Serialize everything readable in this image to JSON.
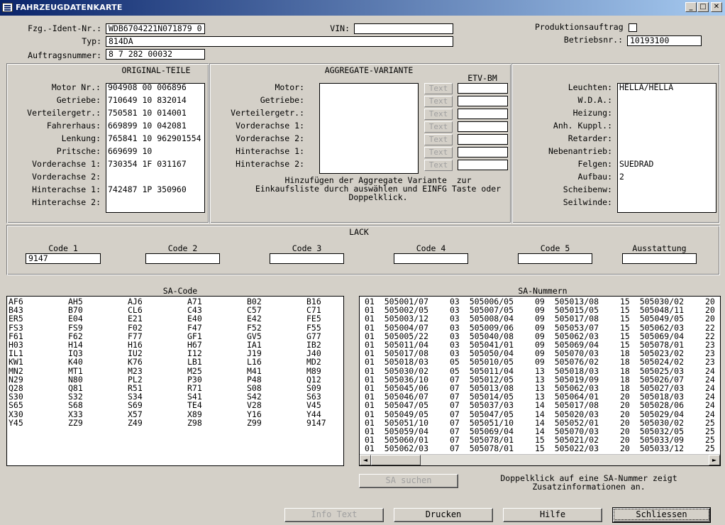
{
  "window": {
    "title": "FAHRZEUGDATENKARTE",
    "min_glyph": "_",
    "max_glyph": "□",
    "close_glyph": "✕"
  },
  "header": {
    "fzg_label": "Fzg.-Ident-Nr.:",
    "fzg_value": "WDB6704221N071879 0",
    "vin_label": "VIN:",
    "vin_value": "",
    "typ_label": "Typ:",
    "typ_value": "814DA",
    "auftrag_label": "Auftragsnummer:",
    "auftrag_value": "8 7 282 00032",
    "produktion_label": "Produktionsauftrag",
    "betrieb_label": "Betriebsnr.:",
    "betrieb_value": "10193100"
  },
  "original": {
    "title": "ORIGINAL-TEILE",
    "rows": [
      {
        "label": "Motor Nr.:",
        "value": "904908 00 006896"
      },
      {
        "label": "Getriebe:",
        "value": "710649 10 832014"
      },
      {
        "label": "Verteilergetr.:",
        "value": "750581 10 014001"
      },
      {
        "label": "Fahrerhaus:",
        "value": "669899 10 042081"
      },
      {
        "label": "Lenkung:",
        "value": "765841 10 962901554"
      },
      {
        "label": "Pritsche:",
        "value": "669699 10"
      },
      {
        "label": "Vorderachse 1:",
        "value": "730354 1F 031167"
      },
      {
        "label": "Vorderachse 2:",
        "value": ""
      },
      {
        "label": "Hinterachse 1:",
        "value": "742487 1P 350960"
      },
      {
        "label": "Hinterachse 2:",
        "value": ""
      }
    ]
  },
  "aggregate": {
    "title": "AGGREGATE-VARIANTE",
    "etv_header": "ETV-BM",
    "text_button": "Text",
    "rows": [
      "Motor:",
      "Getriebe:",
      "Verteilergetr.:",
      "Vorderachse 1:",
      "Vorderachse 2:",
      "Hinterachse 1:",
      "Hinterachse 2:"
    ],
    "hint_lines": [
      "Hinzufügen der Aggregate Variante  zur",
      "Einkaufsliste durch auswählen und EINFG Taste oder",
      "Doppelklick."
    ]
  },
  "equipment": {
    "rows": [
      {
        "label": "Leuchten:",
        "value": "HELLA/HELLA"
      },
      {
        "label": "W.D.A.:",
        "value": ""
      },
      {
        "label": "Heizung:",
        "value": ""
      },
      {
        "label": "Anh. Kuppl.:",
        "value": ""
      },
      {
        "label": "Retarder:",
        "value": ""
      },
      {
        "label": "Nebenantrieb:",
        "value": ""
      },
      {
        "label": "Felgen:",
        "value": "SUEDRAD"
      },
      {
        "label": "Aufbau:",
        "value": "2"
      },
      {
        "label": "Scheibenw:",
        "value": ""
      },
      {
        "label": "Seilwinde:",
        "value": ""
      }
    ]
  },
  "lack": {
    "title": "LACK",
    "fields": [
      {
        "label": "Code 1",
        "value": "9147"
      },
      {
        "label": "Code 2",
        "value": ""
      },
      {
        "label": "Code 3",
        "value": ""
      },
      {
        "label": "Code 4",
        "value": ""
      },
      {
        "label": "Code 5",
        "value": ""
      },
      {
        "label": "Ausstattung",
        "value": ""
      }
    ]
  },
  "sa_code": {
    "title": "SA-Code",
    "rows": [
      [
        "AF6",
        "AH5",
        "AJ6",
        "A71",
        "B02",
        "B16"
      ],
      [
        "B43",
        "B70",
        "CL6",
        "C43",
        "C57",
        "C71"
      ],
      [
        "ER5",
        "E04",
        "E21",
        "E40",
        "E42",
        "FE5"
      ],
      [
        "FS3",
        "FS9",
        "F02",
        "F47",
        "F52",
        "F55"
      ],
      [
        "F61",
        "F62",
        "F77",
        "GF1",
        "GV5",
        "G77"
      ],
      [
        "H03",
        "H14",
        "H16",
        "H67",
        "IA1",
        "IB2"
      ],
      [
        "IL1",
        "IQ3",
        "IU2",
        "I12",
        "J19",
        "J40"
      ],
      [
        "KW1",
        "K40",
        "K76",
        "LB1",
        "L16",
        "MD2"
      ],
      [
        "MN2",
        "MT1",
        "M23",
        "M25",
        "M41",
        "M89"
      ],
      [
        "N29",
        "N80",
        "PL2",
        "P30",
        "P48",
        "Q12"
      ],
      [
        "Q28",
        "Q81",
        "R51",
        "R71",
        "S08",
        "S09"
      ],
      [
        "S30",
        "S32",
        "S34",
        "S41",
        "S42",
        "S63"
      ],
      [
        "S65",
        "S68",
        "S69",
        "TE4",
        "V28",
        "V45"
      ],
      [
        "X30",
        "X33",
        "X57",
        "X89",
        "Y16",
        "Y44"
      ],
      [
        "Y45",
        "ZZ9",
        "Z49",
        "Z98",
        "Z99",
        "9147"
      ]
    ]
  },
  "sa_nummern": {
    "title": "SA-Nummern",
    "rows": [
      [
        "01  505001/07",
        "03  505006/05",
        "09  505013/08",
        "15  505030/02",
        "20"
      ],
      [
        "01  505002/05",
        "03  505007/05",
        "09  505015/05",
        "15  505048/11",
        "20"
      ],
      [
        "01  505003/12",
        "03  505008/04",
        "09  505017/08",
        "15  505049/05",
        "20"
      ],
      [
        "01  505004/07",
        "03  505009/06",
        "09  505053/07",
        "15  505062/03",
        "22"
      ],
      [
        "01  505005/22",
        "03  505040/08",
        "09  505062/03",
        "15  505069/04",
        "22"
      ],
      [
        "01  505011/04",
        "03  505041/01",
        "09  505069/04",
        "15  505078/01",
        "23"
      ],
      [
        "01  505017/08",
        "03  505050/04",
        "09  505070/03",
        "18  505023/02",
        "23"
      ],
      [
        "01  505018/03",
        "05  505010/05",
        "09  505076/02",
        "18  505024/02",
        "23"
      ],
      [
        "01  505030/02",
        "05  505011/04",
        "13  505018/03",
        "18  505025/03",
        "24"
      ],
      [
        "01  505036/10",
        "07  505012/05",
        "13  505019/09",
        "18  505026/07",
        "24"
      ],
      [
        "01  505045/06",
        "07  505013/08",
        "13  505062/03",
        "18  505027/03",
        "24"
      ],
      [
        "01  505046/07",
        "07  505014/05",
        "13  505064/01",
        "20  505018/03",
        "24"
      ],
      [
        "01  505047/05",
        "07  505037/03",
        "14  505017/08",
        "20  505028/06",
        "24"
      ],
      [
        "01  505049/05",
        "07  505047/05",
        "14  505020/03",
        "20  505029/04",
        "24"
      ],
      [
        "01  505051/10",
        "07  505051/10",
        "14  505052/01",
        "20  505030/02",
        "25"
      ],
      [
        "01  505059/04",
        "07  505069/04",
        "14  505070/03",
        "20  505032/05",
        "25"
      ],
      [
        "01  505060/01",
        "07  505078/01",
        "15  505021/02",
        "20  505033/09",
        "25"
      ],
      [
        "01  505062/03",
        "07  505078/01",
        "15  505022/03",
        "20  505033/12",
        "25"
      ]
    ],
    "scroll_left": "◄",
    "scroll_right": "►"
  },
  "footer": {
    "sa_suchen": "SA suchen",
    "hint_lines": [
      "Doppelklick auf eine SA-Nummer zeigt",
      "Zusatzinformationen an."
    ],
    "info_text": "Info Text",
    "drucken": "Drucken",
    "hilfe": "Hilfe",
    "schliessen": "Schliessen"
  }
}
